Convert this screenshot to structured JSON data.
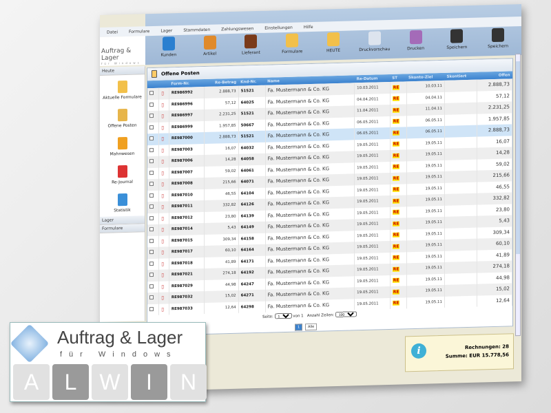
{
  "menu": [
    "Datei",
    "Formulare",
    "Lager",
    "Stammdaten",
    "Zahlungswesen",
    "Einstellungen",
    "Hilfe"
  ],
  "app_logo": {
    "title": "Auftrag & Lager",
    "subtitle": "für Windows"
  },
  "toolbar": [
    {
      "label": "Kunden",
      "color": "#2a7fd0"
    },
    {
      "label": "Artikel",
      "color": "#e08a2a"
    },
    {
      "label": "Lieferant",
      "color": "#7a3a1a"
    },
    {
      "label": "Formulare",
      "color": "#f2c04a"
    },
    {
      "label": "HEUTE",
      "color": "#f2c04a"
    },
    {
      "label": "Druckvorschau",
      "color": "#dde4ee"
    },
    {
      "label": "Drucken",
      "color": "#a46bb8"
    },
    {
      "label": "Speichern",
      "color": "#333333"
    },
    {
      "label": "Speichern",
      "color": "#333333"
    }
  ],
  "sidebar": {
    "sections": [
      "Heute",
      "Lager",
      "Formulare"
    ],
    "items": [
      {
        "label": "Aktuelle Formulare",
        "color": "#f2c04a"
      },
      {
        "label": "Offene Posten",
        "color": "#e7b54a"
      },
      {
        "label": "Mahnwesen",
        "color": "#f0a020"
      },
      {
        "label": "Re-Journal",
        "color": "#d33"
      },
      {
        "label": "Statistik",
        "color": "#3a8fd8"
      }
    ]
  },
  "panel": {
    "title": "Offene Posten",
    "columns": [
      "",
      "",
      "Form-Nr.",
      "Re-Betrag",
      "Knd-Nr.",
      "Name",
      "Re-Datum",
      "ST",
      "Skonto-Ziel",
      "Skontiert",
      "Offen"
    ],
    "rows": [
      [
        "RE986992",
        "2.888,73",
        "51521",
        "Fa. Mustermann & Co. KG",
        "10.03.2011",
        "RE",
        "10.03.11",
        "",
        "2.888,73"
      ],
      [
        "RE986996",
        "57,12",
        "64025",
        "Fa. Mustermann & Co. KG",
        "04.04.2011",
        "RE",
        "04.04.11",
        "",
        "57,12"
      ],
      [
        "RE986997",
        "2.231,25",
        "51521",
        "Fa. Mustermann & Co. KG",
        "11.04.2011",
        "RE",
        "11.04.11",
        "",
        "2.231,25"
      ],
      [
        "RE986999",
        "1.957,85",
        "50667",
        "Fa. Mustermann & Co. KG",
        "06.05.2011",
        "RE",
        "06.05.11",
        "",
        "1.957,85"
      ],
      [
        "RE987000",
        "2.888,73",
        "51521",
        "Fa. Mustermann & Co. KG",
        "06.05.2011",
        "RE",
        "06.05.11",
        "",
        "2.888,73"
      ],
      [
        "RE987003",
        "16,07",
        "64032",
        "Fa. Mustermann & Co. KG",
        "19.05.2011",
        "RE",
        "19.05.11",
        "",
        "16,07"
      ],
      [
        "RE987006",
        "14,28",
        "64058",
        "Fa. Mustermann & Co. KG",
        "19.05.2011",
        "RE",
        "19.05.11",
        "",
        "14,28"
      ],
      [
        "RE987007",
        "59,02",
        "64061",
        "Fa. Mustermann & Co. KG",
        "19.05.2011",
        "RE",
        "19.05.11",
        "",
        "59,02"
      ],
      [
        "RE987008",
        "215,66",
        "64071",
        "Fa. Mustermann & Co. KG",
        "19.05.2011",
        "RE",
        "19.05.11",
        "",
        "215,66"
      ],
      [
        "RE987010",
        "46,55",
        "64104",
        "Fa. Mustermann & Co. KG",
        "19.05.2011",
        "RE",
        "19.05.11",
        "",
        "46,55"
      ],
      [
        "RE987011",
        "332,82",
        "64126",
        "Fa. Mustermann & Co. KG",
        "19.05.2011",
        "RE",
        "19.05.11",
        "",
        "332,82"
      ],
      [
        "RE987012",
        "23,80",
        "64139",
        "Fa. Mustermann & Co. KG",
        "19.05.2011",
        "RE",
        "19.05.11",
        "",
        "23,80"
      ],
      [
        "RE987014",
        "5,43",
        "64149",
        "Fa. Mustermann & Co. KG",
        "19.05.2011",
        "RE",
        "19.05.11",
        "",
        "5,43"
      ],
      [
        "RE987015",
        "309,34",
        "64158",
        "Fa. Mustermann & Co. KG",
        "19.05.2011",
        "RE",
        "19.05.11",
        "",
        "309,34"
      ],
      [
        "RE987017",
        "60,10",
        "64164",
        "Fa. Mustermann & Co. KG",
        "19.05.2011",
        "RE",
        "19.05.11",
        "",
        "60,10"
      ],
      [
        "RE987018",
        "41,89",
        "64171",
        "Fa. Mustermann & Co. KG",
        "19.05.2011",
        "RE",
        "19.05.11",
        "",
        "41,89"
      ],
      [
        "RE987021",
        "274,18",
        "64192",
        "Fa. Mustermann & Co. KG",
        "19.05.2011",
        "RE",
        "19.05.11",
        "",
        "274,18"
      ],
      [
        "RE987029",
        "44,98",
        "64247",
        "Fa. Mustermann & Co. KG",
        "19.05.2011",
        "RE",
        "19.05.11",
        "",
        "44,98"
      ],
      [
        "RE987032",
        "15,02",
        "64271",
        "Fa. Mustermann & Co. KG",
        "19.05.2011",
        "RE",
        "19.05.11",
        "",
        "15,02"
      ],
      [
        "RE987033",
        "12,64",
        "64298",
        "Fa. Mustermann & Co. KG",
        "19.05.2011",
        "RE",
        "19.05.11",
        "",
        "12,64"
      ]
    ],
    "selected_row": 4
  },
  "pager": {
    "page_label": "Seite:",
    "page_value": "1",
    "of_label": "von 1",
    "rows_label": "Anzahl Zeilen:",
    "rows_value": "100",
    "page_button": "1",
    "all_button": "Alle"
  },
  "summary": {
    "count": "Rechnungen: 28",
    "sum": "Summe: EUR 15.778,56"
  },
  "brand_logo": {
    "title": "Auftrag & Lager",
    "subtitle": "für Windows",
    "letters": [
      "A",
      "L",
      "W",
      "I",
      "N"
    ]
  }
}
